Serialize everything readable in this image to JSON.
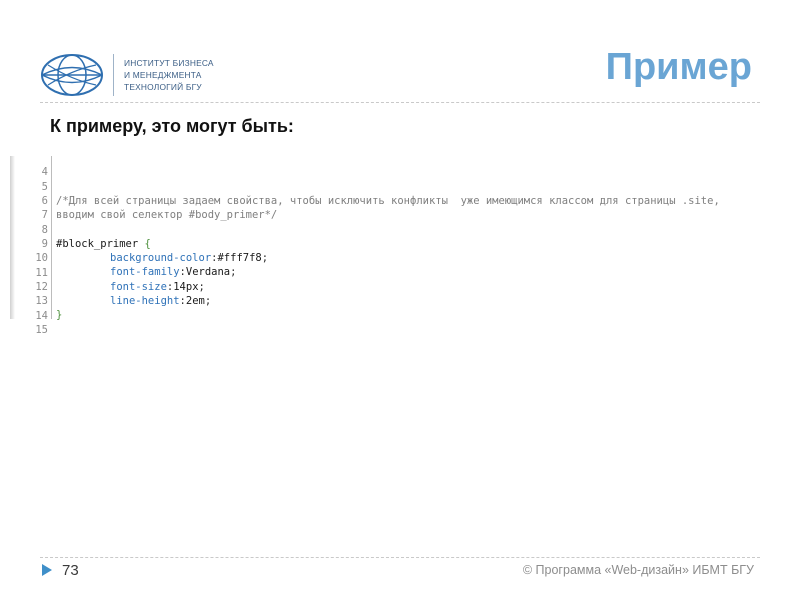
{
  "header": {
    "institute_lines": [
      "ИНСТИТУТ БИЗНЕСА",
      "И МЕНЕДЖМЕНТА",
      "ТЕХНОЛОГИЙ БГУ"
    ],
    "title": "Пример"
  },
  "subtitle": "К примеру, это могут быть:",
  "code": {
    "line_numbers": [
      "4",
      "5",
      "6",
      "7",
      "8",
      "9",
      "10",
      "11",
      "12",
      "13",
      "14",
      "15"
    ],
    "comment_line1": "/*Для всей страницы задаем свойства, чтобы исключить конфликты  уже имеющимся классом для страницы .site,",
    "comment_line2": "вводим свой селектор #body_primer*/",
    "selector": "#block_primer",
    "open_brace": " {",
    "close_brace": "}",
    "declarations": [
      {
        "prop": "background-color",
        "value": "#fff7f8"
      },
      {
        "prop": "font-family",
        "value": "Verdana"
      },
      {
        "prop": "font-size",
        "value": "14px"
      },
      {
        "prop": "line-height",
        "value": "2em"
      }
    ]
  },
  "footer": {
    "page_number": "73",
    "copyright": "© Программа «Web-дизайн» ИБМТ БГУ"
  },
  "colors": {
    "title": "#6aa5d4",
    "institute_text": "#3b5e86",
    "footer_arrow": "#3f8fc9"
  }
}
